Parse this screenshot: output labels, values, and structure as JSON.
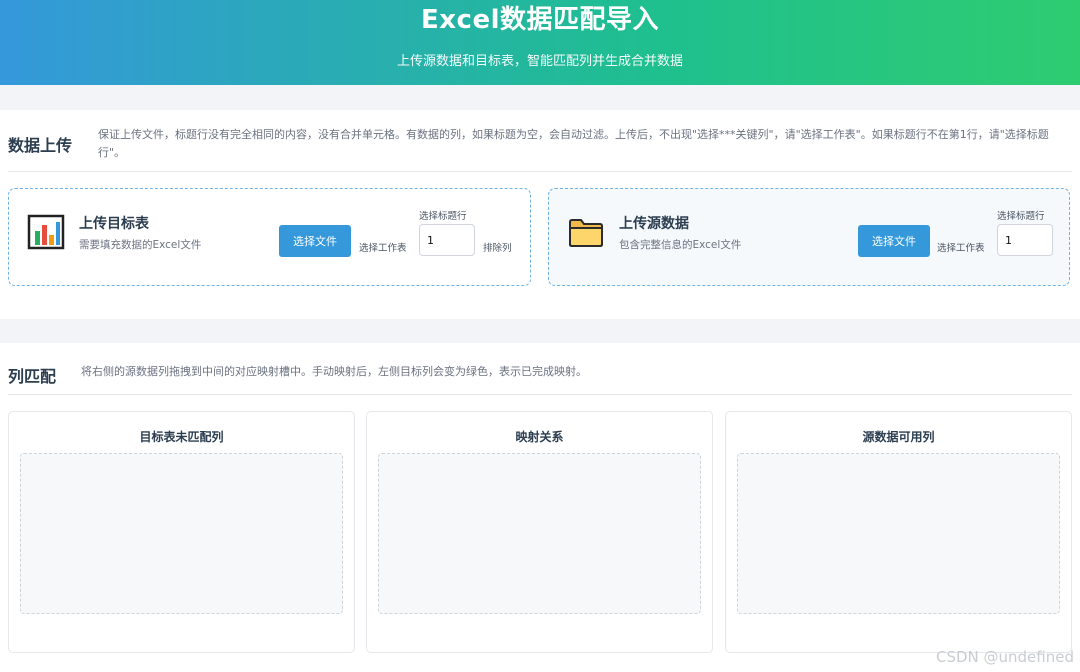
{
  "header": {
    "title": "Excel数据匹配导入",
    "subtitle": "上传源数据和目标表，智能匹配列并生成合并数据"
  },
  "upload_section": {
    "title": "数据上传",
    "description": "保证上传文件，标题行没有完全相同的内容，没有合并单元格。有数据的列，如果标题为空，会自动过滤。上传后，不出现\"选择***关键列\"，请\"选择工作表\"。如果标题行不在第1行，请\"选择标题行\"。",
    "target": {
      "icon": "bar-chart-icon",
      "title": "上传目标表",
      "description": "需要填充数据的Excel文件",
      "choose_button": "选择文件",
      "sheet_label": "选择工作表",
      "header_row_label": "选择标题行",
      "header_row_value": "1",
      "exclude_label": "排除列"
    },
    "source": {
      "icon": "folder-icon",
      "title": "上传源数据",
      "description": "包含完整信息的Excel文件",
      "choose_button": "选择文件",
      "sheet_label": "选择工作表",
      "header_row_label": "选择标题行",
      "header_row_value": "1"
    }
  },
  "match_section": {
    "title": "列匹配",
    "description": "将右侧的源数据列拖拽到中间的对应映射槽中。手动映射后，左侧目标列会变为绿色，表示已完成映射。",
    "columns": [
      {
        "title": "目标表未匹配列"
      },
      {
        "title": "映射关系"
      },
      {
        "title": "源数据可用列"
      }
    ]
  },
  "watermark": "CSDN @undefined",
  "colors": {
    "accent": "#3498db",
    "gradient_end": "#2ecc71"
  }
}
